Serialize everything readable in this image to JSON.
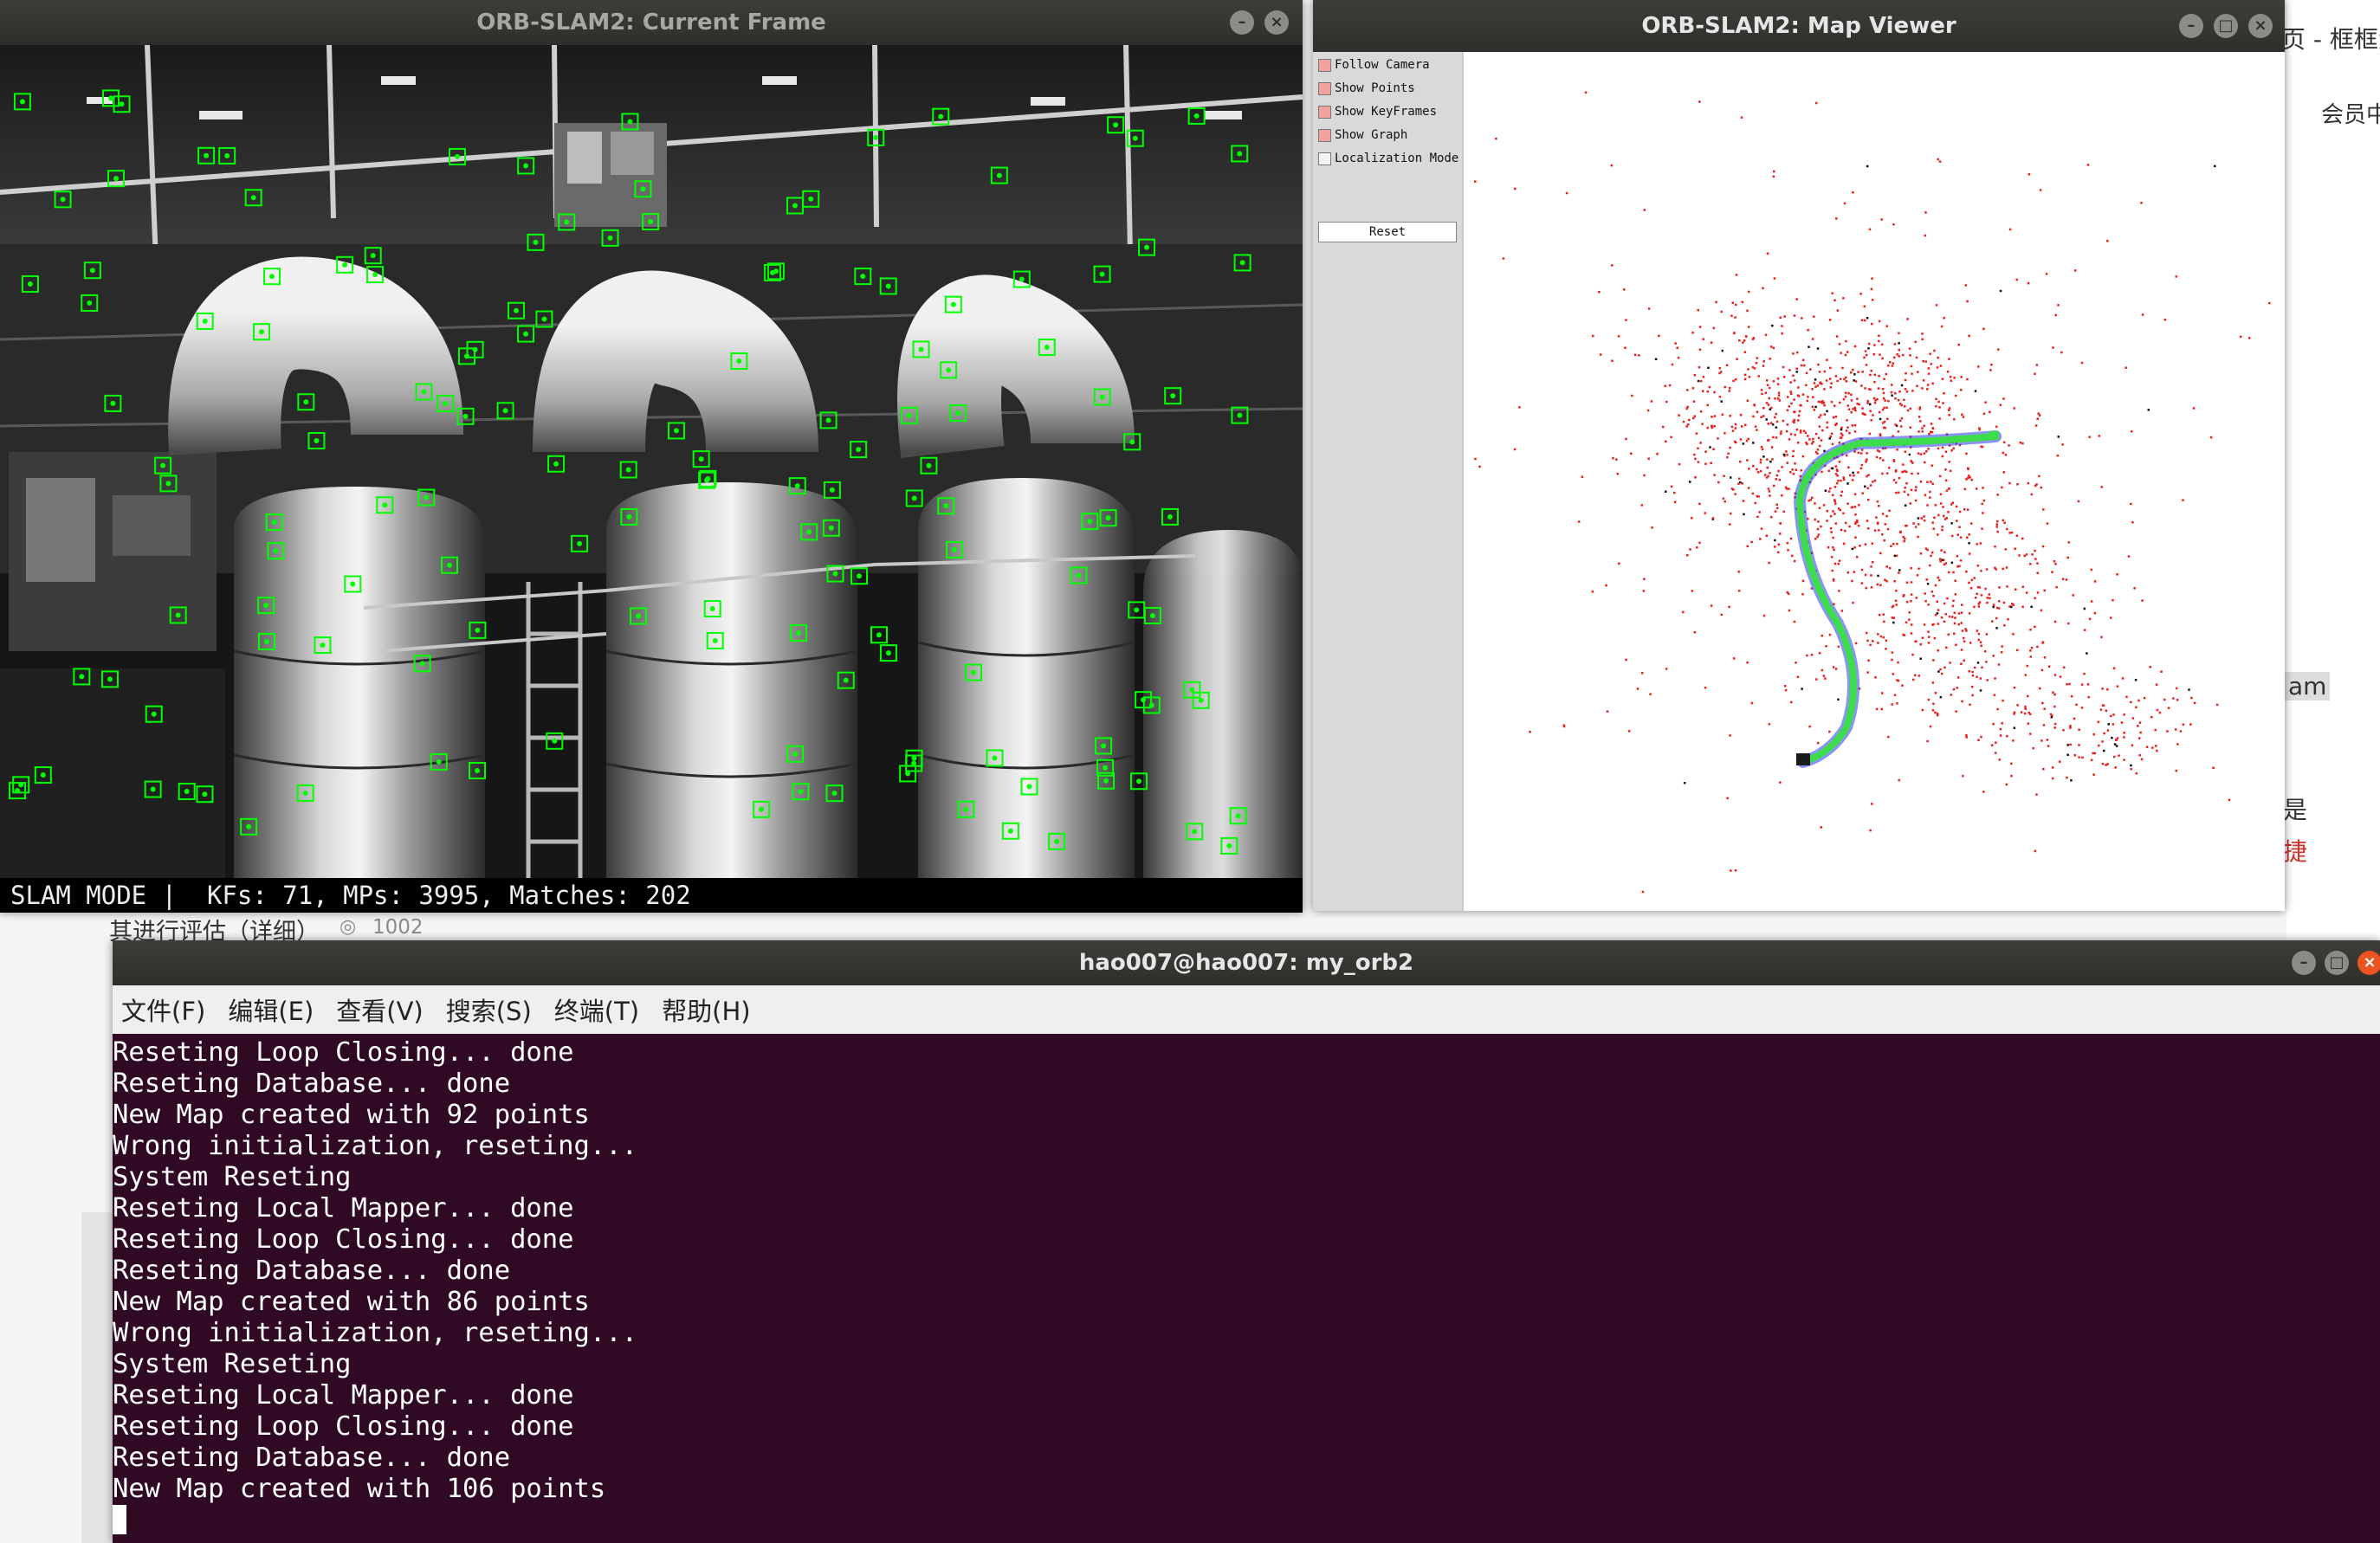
{
  "background_page": {
    "fragments": {
      "top_right": "页 - 框框大",
      "member": "会员中",
      "sidebar_text": "其进行评估（详细）",
      "view_count": "1002",
      "edge_am": "am",
      "edge_shi": "是",
      "edge_jie": "捷"
    }
  },
  "frame_window": {
    "title": "ORB-SLAM2: Current Frame",
    "status": "SLAM MODE |  KFs: 71, MPs: 3995, Matches: 202",
    "accent": "#00ff00"
  },
  "map_window": {
    "title": "ORB-SLAM2: Map Viewer",
    "options": [
      {
        "label": "Follow Camera",
        "checked": true
      },
      {
        "label": "Show Points",
        "checked": true
      },
      {
        "label": "Show KeyFrames",
        "checked": true
      },
      {
        "label": "Show Graph",
        "checked": true
      },
      {
        "label": "Localization Mode",
        "checked": false
      }
    ],
    "reset_label": "Reset",
    "colors": {
      "points": "#e8201e",
      "trajectory": "#3ddc4a",
      "keyframes": "#2a3cf0"
    }
  },
  "terminal_window": {
    "title": "hao007@hao007: my_orb2",
    "menu": [
      "文件(F)",
      "编辑(E)",
      "查看(V)",
      "搜索(S)",
      "终端(T)",
      "帮助(H)"
    ],
    "lines": [
      "Reseting Loop Closing... done",
      "Reseting Database... done",
      "New Map created with 92 points",
      "Wrong initialization, reseting...",
      "System Reseting",
      "Reseting Local Mapper... done",
      "Reseting Loop Closing... done",
      "Reseting Database... done",
      "New Map created with 86 points",
      "Wrong initialization, reseting...",
      "System Reseting",
      "Reseting Local Mapper... done",
      "Reseting Loop Closing... done",
      "Reseting Database... done",
      "New Map created with 106 points"
    ],
    "bg_color": "#300a24"
  }
}
